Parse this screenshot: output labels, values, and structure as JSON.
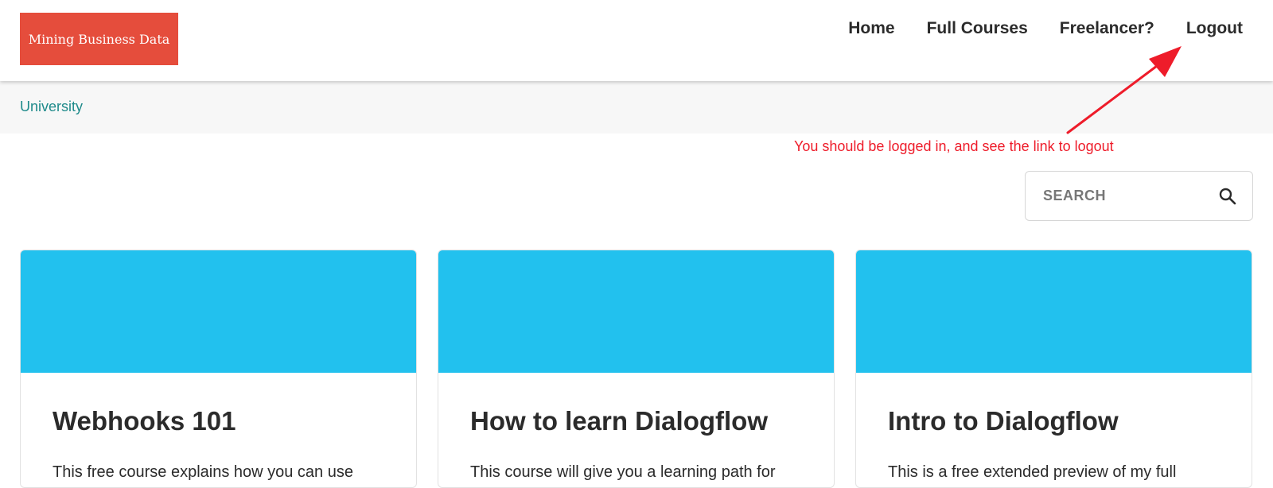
{
  "header": {
    "logo_text": "Mining Business Data",
    "nav": [
      {
        "label": "Home"
      },
      {
        "label": "Full Courses"
      },
      {
        "label": "Freelancer?"
      },
      {
        "label": "Logout"
      }
    ]
  },
  "breadcrumb": {
    "label": "University"
  },
  "annotation": {
    "text": "You should be logged in, and see the link to logout",
    "color": "#ee1c2a"
  },
  "search": {
    "placeholder": "SEARCH",
    "icon": "search-icon"
  },
  "courses": [
    {
      "title": "Webhooks 101",
      "description": "This free course explains how you can use"
    },
    {
      "title": "How to learn Dialogflow",
      "description": "This course will give you a learning path for"
    },
    {
      "title": "Intro to Dialogflow",
      "description": "This is a free extended preview of my full"
    }
  ],
  "colors": {
    "logo_bg": "#e54d3c",
    "card_header": "#22c1ee",
    "breadcrumb_link": "#1e8a8a"
  }
}
